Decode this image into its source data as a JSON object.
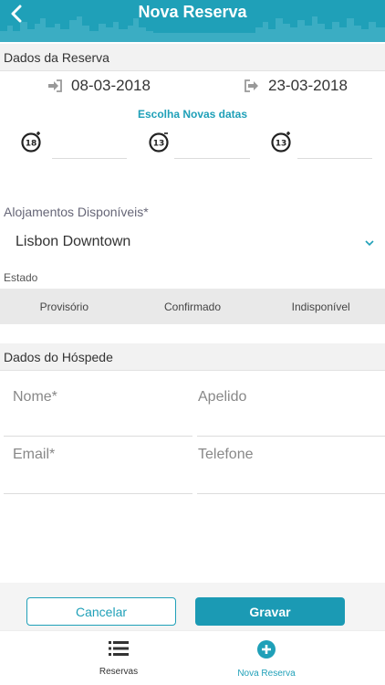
{
  "header": {
    "title": "Nova Reserva"
  },
  "reservation": {
    "section_title": "Dados da Reserva",
    "checkin": "08-03-2018",
    "checkout": "23-03-2018",
    "choose_dates": "Escolha Novas datas",
    "age_fields": [
      {
        "badge": "18+",
        "value": ""
      },
      {
        "badge": "13-",
        "value": ""
      },
      {
        "badge": "13+",
        "value": ""
      }
    ]
  },
  "accommodation": {
    "label": "Alojamentos Disponíveis*",
    "selected": "Lisbon Downtown"
  },
  "status": {
    "label": "Estado",
    "options": [
      "Provisório",
      "Confirmado",
      "Indisponível"
    ]
  },
  "guest": {
    "section_title": "Dados do Hóspede",
    "first_name_label": "Nome*",
    "last_name_label": "Apelido",
    "email_label": "Email*",
    "phone_label": "Telefone"
  },
  "actions": {
    "cancel": "Cancelar",
    "save": "Gravar"
  },
  "tabs": {
    "reservations": "Reservas",
    "new_reservation": "Nova Reserva"
  },
  "colors": {
    "accent": "#1fa0b8"
  }
}
